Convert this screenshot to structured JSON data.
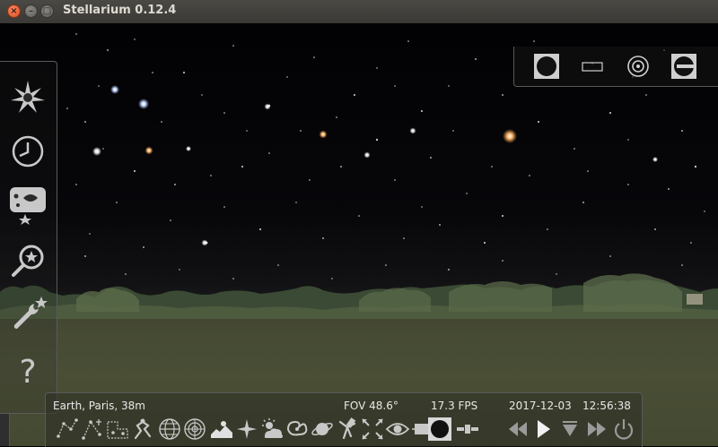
{
  "window": {
    "title": "Stellarium 0.12.4"
  },
  "titlebar_buttons": {
    "close": "×",
    "minimize": "–",
    "maximize": "□"
  },
  "status": {
    "location": "Earth, Paris, 38m",
    "fov": "FOV 48.6°",
    "fps": "17.3 FPS",
    "date": "2017-12-03",
    "time": "12:56:38"
  },
  "left_toolbar": [
    {
      "icon": "location-window-icon"
    },
    {
      "icon": "date-time-window-icon"
    },
    {
      "icon": "sky-viewing-options-icon"
    },
    {
      "icon": "search-window-icon"
    },
    {
      "icon": "configuration-window-icon"
    },
    {
      "icon": "help-window-icon"
    }
  ],
  "top_toolbar": [
    {
      "icon": "ocular-view-icon"
    },
    {
      "icon": "sensor-frame-icon"
    },
    {
      "icon": "telrad-sight-icon"
    },
    {
      "icon": "ocular-config-icon"
    }
  ],
  "bottom_toolbar": [
    {
      "icon": "constellation-lines-icon"
    },
    {
      "icon": "constellation-labels-icon"
    },
    {
      "icon": "constellation-boundaries-icon"
    },
    {
      "icon": "constellation-art-icon"
    },
    {
      "icon": "equatorial-grid-icon"
    },
    {
      "icon": "azimuthal-grid-icon"
    },
    {
      "icon": "ground-icon"
    },
    {
      "icon": "cardinal-points-icon"
    },
    {
      "icon": "atmosphere-icon"
    },
    {
      "icon": "nebulae-icon"
    },
    {
      "icon": "planet-labels-icon"
    },
    {
      "icon": "equatorial-mount-icon"
    },
    {
      "icon": "center-selected-icon"
    },
    {
      "icon": "night-mode-icon"
    },
    {
      "icon": "full-screen-icon"
    },
    {
      "icon": "ocular-toolbar-icon"
    },
    {
      "icon": "satellite-icon"
    },
    {
      "icon": "decrease-time-speed-icon"
    },
    {
      "icon": "play-icon"
    },
    {
      "icon": "current-time-icon"
    },
    {
      "icon": "increase-time-speed-icon"
    },
    {
      "icon": "quit-icon"
    }
  ],
  "colors": {
    "icon": "#c8c8c8",
    "icon_active": "#ffffff",
    "text": "#e8e8e8"
  }
}
